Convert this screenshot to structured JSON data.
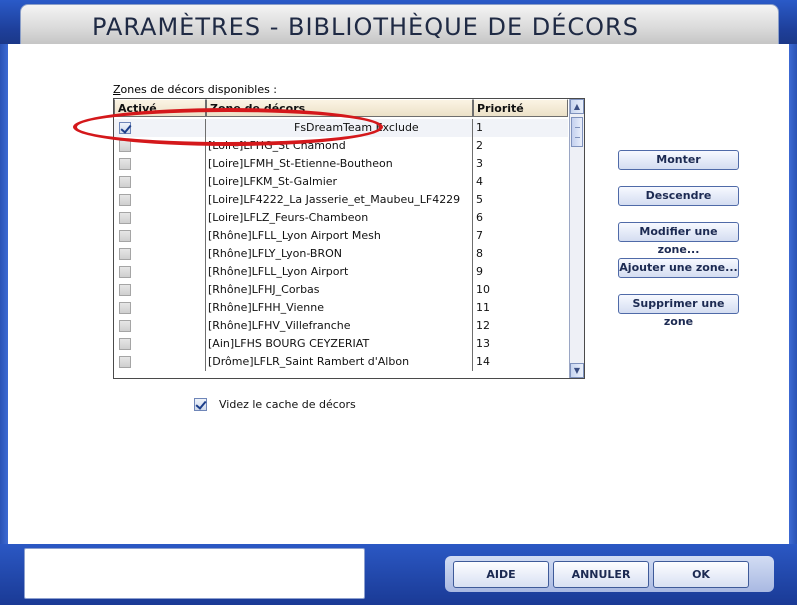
{
  "window": {
    "title": "PARAMÈTRES - BIBLIOTHÈQUE DE DÉCORS"
  },
  "list": {
    "label": "Zones de décors disponibles :",
    "label_accel": "Z",
    "label_rest": "ones de décors disponibles :",
    "columns": [
      "Activé",
      "Zone de décors",
      "Priorité"
    ],
    "rows": [
      {
        "active": true,
        "name": "FsDreamTeam Exclude",
        "priority": "1"
      },
      {
        "active": false,
        "name": "[Loire]LFHG_St Chamond",
        "priority": "2"
      },
      {
        "active": false,
        "name": "[Loire]LFMH_St-Etienne-Boutheon",
        "priority": "3"
      },
      {
        "active": false,
        "name": "[Loire]LFKM_St-Galmier",
        "priority": "4"
      },
      {
        "active": false,
        "name": "[Loire]LF4222_La Jasserie_et_Maubeu_LF4229",
        "priority": "5"
      },
      {
        "active": false,
        "name": "[Loire]LFLZ_Feurs-Chambeon",
        "priority": "6"
      },
      {
        "active": false,
        "name": "[Rhône]LFLL_Lyon Airport Mesh",
        "priority": "7"
      },
      {
        "active": false,
        "name": "[Rhône]LFLY_Lyon-BRON",
        "priority": "8"
      },
      {
        "active": false,
        "name": "[Rhône]LFLL_Lyon Airport",
        "priority": "9"
      },
      {
        "active": false,
        "name": "[Rhône]LFHJ_Corbas",
        "priority": "10"
      },
      {
        "active": false,
        "name": "[Rhône]LFHH_Vienne",
        "priority": "11"
      },
      {
        "active": false,
        "name": "[Rhône]LFHV_Villefranche",
        "priority": "12"
      },
      {
        "active": false,
        "name": "[Ain]LFHS BOURG CEYZERIAT",
        "priority": "13"
      },
      {
        "active": false,
        "name": "[Drôme]LFLR_Saint Rambert d'Albon",
        "priority": "14"
      }
    ]
  },
  "side_buttons": {
    "monter": "Monter",
    "descendre": "Descendre",
    "modifier": "Modifier une zone...",
    "ajouter": "Ajouter une zone...",
    "supprimer": "Supprimer une zone"
  },
  "cache": {
    "label": "Videz le cache de décors",
    "checked": true
  },
  "bottom_buttons": {
    "aide": "AIDE",
    "annuler": "ANNULER",
    "ok": "OK"
  },
  "annotation": {
    "color": "#d4181b"
  }
}
